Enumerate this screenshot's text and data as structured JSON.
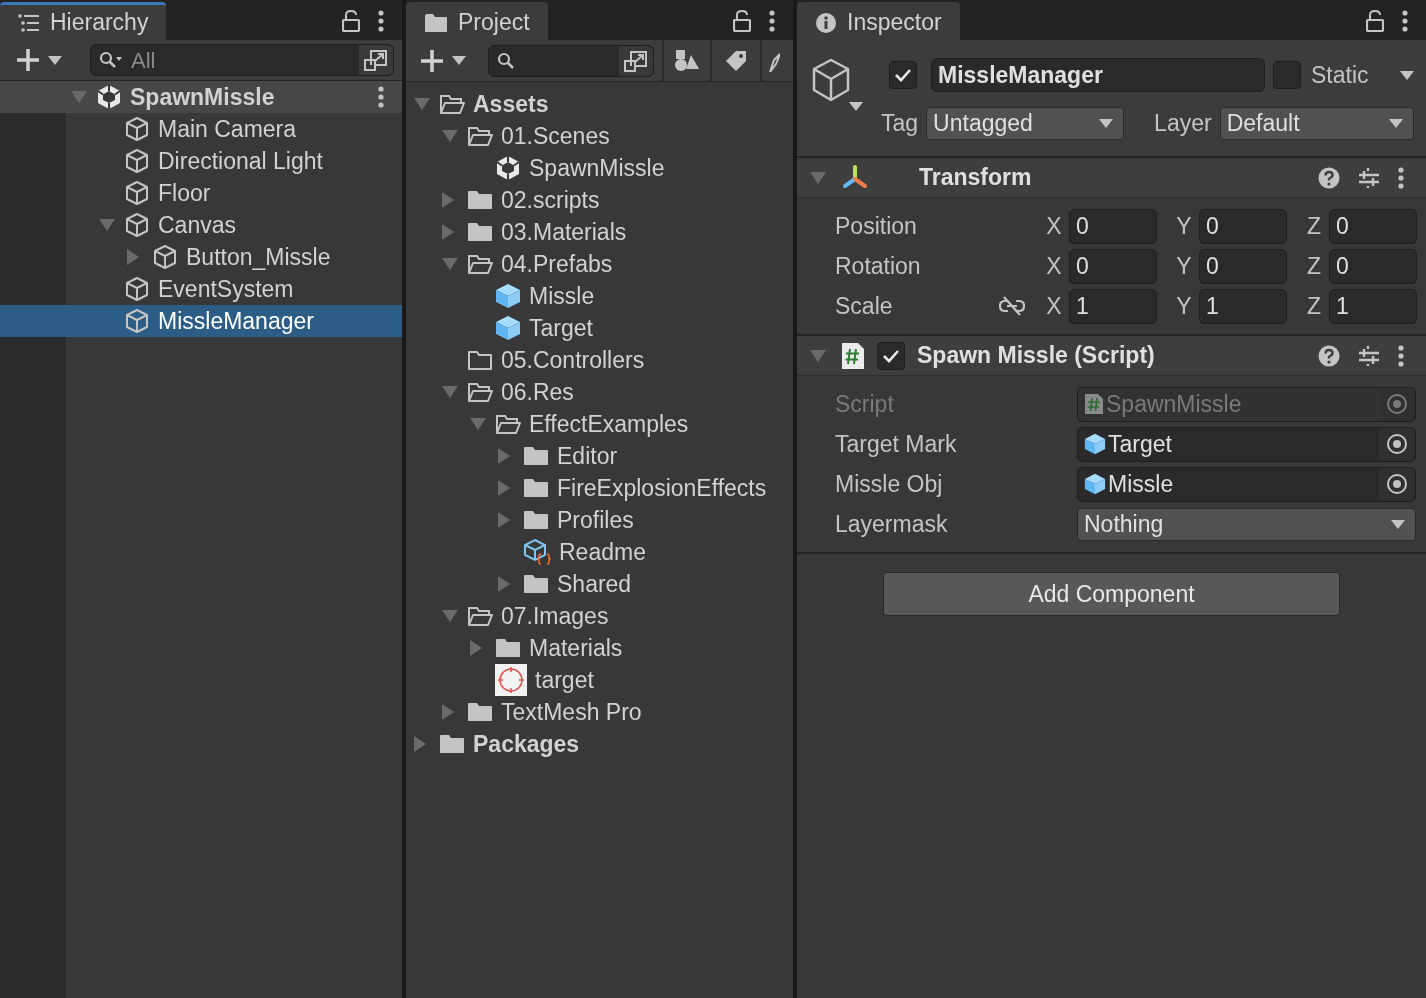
{
  "hierarchy": {
    "title": "Hierarchy",
    "focused": true,
    "search": {
      "placeholder": "All"
    },
    "tree": [
      {
        "label": "SpawnMissle",
        "kind": "scene",
        "expanded": true,
        "selected": false,
        "children": [
          {
            "label": "Main Camera",
            "kind": "gameobject",
            "selected": false
          },
          {
            "label": "Directional Light",
            "kind": "gameobject",
            "selected": false
          },
          {
            "label": "Floor",
            "kind": "gameobject",
            "selected": false
          },
          {
            "label": "Canvas",
            "kind": "gameobject",
            "expanded": true,
            "selected": false,
            "children": [
              {
                "label": "Button_Missle",
                "kind": "gameobject",
                "expanded": false,
                "selected": false
              }
            ]
          },
          {
            "label": "EventSystem",
            "kind": "gameobject",
            "selected": false
          },
          {
            "label": "MissleManager",
            "kind": "gameobject",
            "selected": true
          }
        ]
      }
    ]
  },
  "project": {
    "title": "Project",
    "focused": false,
    "tree": [
      {
        "label": "Assets",
        "kind": "folder",
        "expanded": true,
        "children": [
          {
            "label": "01.Scenes",
            "kind": "folder",
            "expanded": true,
            "children": [
              {
                "label": "SpawnMissle",
                "kind": "scene"
              }
            ]
          },
          {
            "label": "02.scripts",
            "kind": "folder",
            "expanded": false
          },
          {
            "label": "03.Materials",
            "kind": "folder",
            "expanded": false
          },
          {
            "label": "04.Prefabs",
            "kind": "folder",
            "expanded": true,
            "children": [
              {
                "label": "Missle",
                "kind": "prefab"
              },
              {
                "label": "Target",
                "kind": "prefab"
              }
            ]
          },
          {
            "label": "05.Controllers",
            "kind": "empty-folder"
          },
          {
            "label": "06.Res",
            "kind": "folder",
            "expanded": true,
            "children": [
              {
                "label": "EffectExamples",
                "kind": "folder",
                "expanded": true,
                "children": [
                  {
                    "label": "Editor",
                    "kind": "folder",
                    "expanded": false
                  },
                  {
                    "label": "FireExplosionEffects",
                    "kind": "folder",
                    "expanded": false
                  },
                  {
                    "label": "Profiles",
                    "kind": "folder",
                    "expanded": false
                  },
                  {
                    "label": "Readme",
                    "kind": "readme"
                  },
                  {
                    "label": "Shared",
                    "kind": "folder",
                    "expanded": false
                  }
                ]
              }
            ]
          },
          {
            "label": "07.Images",
            "kind": "folder",
            "expanded": true,
            "children": [
              {
                "label": "Materials",
                "kind": "folder",
                "expanded": false
              },
              {
                "label": "target",
                "kind": "texture"
              }
            ]
          },
          {
            "label": "TextMesh Pro",
            "kind": "folder",
            "expanded": false
          }
        ]
      },
      {
        "label": "Packages",
        "kind": "folder",
        "expanded": false
      }
    ]
  },
  "inspector": {
    "title": "Inspector",
    "focused": false,
    "object": {
      "active": true,
      "name": "MissleManager",
      "static": false,
      "static_label": "Static",
      "tag_label": "Tag",
      "tag": "Untagged",
      "layer_label": "Layer",
      "layer": "Default"
    },
    "components": [
      {
        "kind": "transform",
        "title": "Transform",
        "expanded": true,
        "rows": [
          {
            "label": "Position",
            "axes": [
              {
                "axis": "X",
                "value": "0"
              },
              {
                "axis": "Y",
                "value": "0"
              },
              {
                "axis": "Z",
                "value": "0"
              }
            ]
          },
          {
            "label": "Rotation",
            "axes": [
              {
                "axis": "X",
                "value": "0"
              },
              {
                "axis": "Y",
                "value": "0"
              },
              {
                "axis": "Z",
                "value": "0"
              }
            ]
          },
          {
            "label": "Scale",
            "ratio_lock": false,
            "axes": [
              {
                "axis": "X",
                "value": "1"
              },
              {
                "axis": "Y",
                "value": "1"
              },
              {
                "axis": "Z",
                "value": "1"
              }
            ]
          }
        ]
      },
      {
        "kind": "script",
        "title": "Spawn Missle (Script)",
        "expanded": true,
        "enabled": true,
        "fields": [
          {
            "label": "Script",
            "kind": "script",
            "value": "SpawnMissle",
            "disabled": true
          },
          {
            "label": "Target Mark",
            "kind": "prefab",
            "value": "Target",
            "disabled": false
          },
          {
            "label": "Missle Obj",
            "kind": "prefab",
            "value": "Missle",
            "disabled": false
          },
          {
            "label": "Layermask",
            "kind": "dropdown",
            "value": "Nothing",
            "disabled": false
          }
        ]
      }
    ],
    "add_component": "Add Component"
  }
}
